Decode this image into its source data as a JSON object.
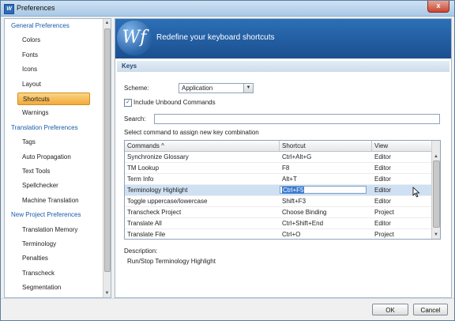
{
  "window": {
    "title": "Preferences",
    "close_label": "x"
  },
  "sidebar": {
    "items": [
      {
        "label": "General Preferences",
        "type": "category"
      },
      {
        "label": "Colors",
        "type": "sub"
      },
      {
        "label": "Fonts",
        "type": "sub"
      },
      {
        "label": "Icons",
        "type": "sub"
      },
      {
        "label": "Layout",
        "type": "sub"
      },
      {
        "label": "Shortcuts",
        "type": "sub",
        "selected": true
      },
      {
        "label": "Warnings",
        "type": "sub"
      },
      {
        "label": "Translation Preferences",
        "type": "category"
      },
      {
        "label": "Tags",
        "type": "sub"
      },
      {
        "label": "Auto Propagation",
        "type": "sub"
      },
      {
        "label": "Text Tools",
        "type": "sub"
      },
      {
        "label": "Spellchecker",
        "type": "sub"
      },
      {
        "label": "Machine Translation",
        "type": "sub"
      },
      {
        "label": "New Project Preferences",
        "type": "category"
      },
      {
        "label": "Translation Memory",
        "type": "sub"
      },
      {
        "label": "Terminology",
        "type": "sub"
      },
      {
        "label": "Penalties",
        "type": "sub"
      },
      {
        "label": "Transcheck",
        "type": "sub"
      },
      {
        "label": "Segmentation",
        "type": "sub"
      }
    ]
  },
  "header": {
    "logo_text": "Wf",
    "banner_text": "Redefine your keyboard shortcuts"
  },
  "keys": {
    "section_title": "Keys",
    "scheme_label": "Scheme:",
    "scheme_value": "Application",
    "include_unbound_label": "Include Unbound Commands",
    "include_unbound_checked": "✓",
    "search_label": "Search:",
    "search_value": "",
    "instruction": "Select command to assign new key combination"
  },
  "table": {
    "columns": [
      "Commands ^",
      "Shortcut",
      "View"
    ],
    "rows": [
      {
        "command": "Synchronize Glossary",
        "shortcut": "Ctrl+Alt+G",
        "view": "Editor"
      },
      {
        "command": "TM Lookup",
        "shortcut": "F8",
        "view": "Editor"
      },
      {
        "command": "Term Info",
        "shortcut": "Alt+T",
        "view": "Editor"
      },
      {
        "command": "Terminology Highlight",
        "shortcut": "Ctrl+F5",
        "view": "Editor",
        "selected": true
      },
      {
        "command": "Toggle uppercase/lowercase",
        "shortcut": "Shift+F3",
        "view": "Editor"
      },
      {
        "command": "Transcheck Project",
        "shortcut": "Choose Binding",
        "view": "Project"
      },
      {
        "command": "Translate All",
        "shortcut": "Ctrl+Shift+End",
        "view": "Editor"
      },
      {
        "command": "Translate File",
        "shortcut": "Ctrl+O",
        "view": "Project"
      }
    ]
  },
  "description": {
    "label": "Description:",
    "text": "Run/Stop Terminology Highlight"
  },
  "buttons": {
    "ok": "OK",
    "cancel": "Cancel"
  },
  "colors": {
    "accent": "#1b4f8f",
    "selection": "#f2a93b"
  }
}
